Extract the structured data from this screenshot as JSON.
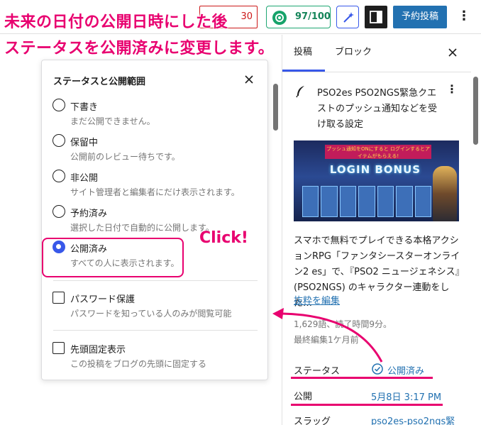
{
  "annotation": {
    "line1": "未来の日付の公開日時にした後",
    "line2": "ステータスを公開済みに変更します。",
    "click": "Click!"
  },
  "toolbar": {
    "save_label": "30",
    "seo_score": "97/100",
    "schedule_label": "予約投稿",
    "more_label": "⋮"
  },
  "popover": {
    "title": "ステータスと公開範囲",
    "options": [
      {
        "label": "下書き",
        "desc": "まだ公開できません。",
        "checked": false
      },
      {
        "label": "保留中",
        "desc": "公開前のレビュー待ちです。",
        "checked": false
      },
      {
        "label": "非公開",
        "desc": "サイト管理者と編集者にだけ表示されます。",
        "checked": false
      },
      {
        "label": "予約済み",
        "desc": "選択した日付で自動的に公開します。",
        "checked": false
      },
      {
        "label": "公開済み",
        "desc": "すべての人に表示されます。",
        "checked": true
      }
    ],
    "password": {
      "label": "パスワード保護",
      "desc": "パスワードを知っている人のみが閲覧可能"
    },
    "sticky": {
      "label": "先頭固定表示",
      "desc": "この投稿をブログの先頭に固定する"
    }
  },
  "sidebar": {
    "tabs": [
      "投稿",
      "ブロック"
    ],
    "post_title": "PSO2es PSO2NGS緊急クエストのプッシュ通知などを受け取る設定",
    "thumbnail": {
      "banner": "プッシュ通知をONにすると ログインするとアイテムがもらえる!",
      "logo": "LOGIN BONUS"
    },
    "excerpt": "スマホで無料でプレイできる本格アクションRPG「ファンタシースターオンライン2 es」で、『PSO2 ニュージェネシス』(PSO2NGS) のキャラクター連動をした…",
    "edit_excerpt": "抜粋を編集",
    "words": "1,629語、読了時間9分。",
    "edited": "最終編集1ケ月前",
    "status_label": "ステータス",
    "status_value": "公開済み",
    "publish_label": "公開",
    "publish_value": "5月8日 3:17 PM",
    "slug_label": "スラッグ",
    "slug_value": "pso2es-pso2ngs緊"
  },
  "colors": {
    "annotation": "#e8006f",
    "accent": "#3858e9",
    "primary_button": "#2271b1",
    "seo_green": "#16a36a"
  }
}
